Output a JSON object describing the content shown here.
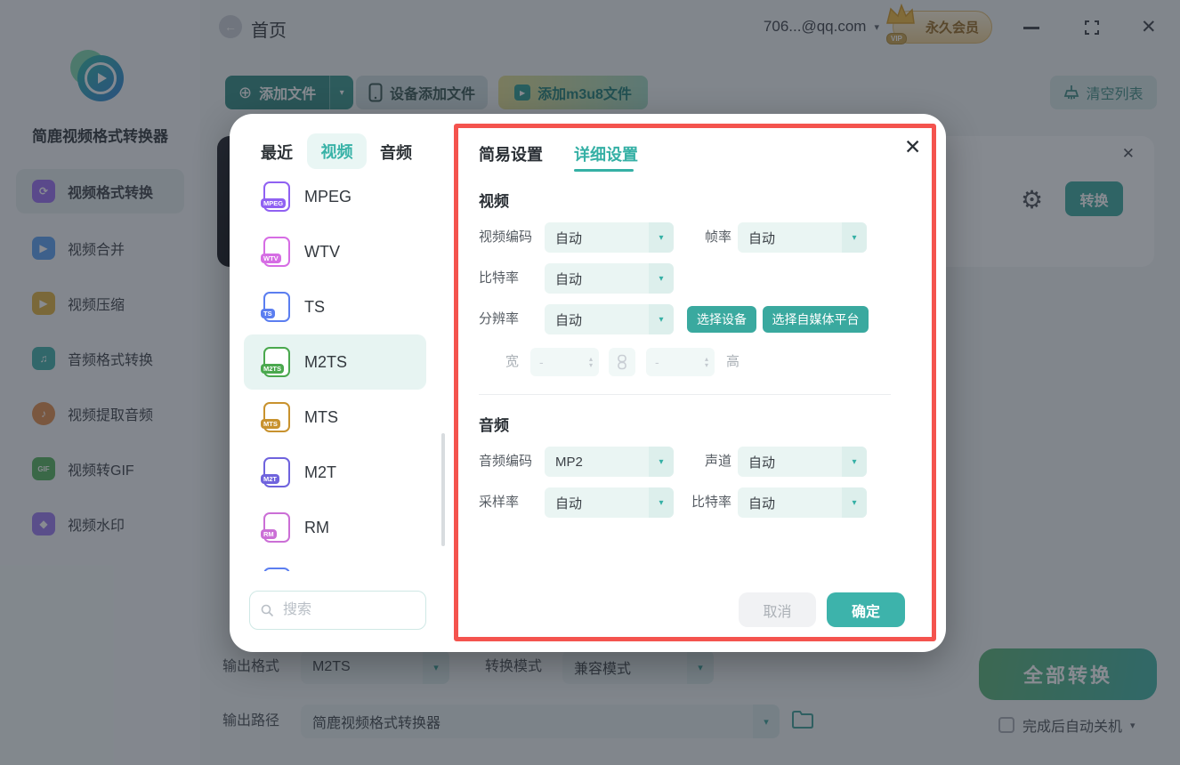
{
  "header": {
    "home": "首页",
    "back_icon": "←",
    "account": "706...@qq.com",
    "vip_badge": "永久会员",
    "vip_tag": "VIP"
  },
  "sidebar": {
    "app_name": "简鹿视频格式转换器",
    "items": [
      {
        "label": "视频格式转换",
        "glyph": "⟳",
        "active": true
      },
      {
        "label": "视频合并",
        "glyph": "▶"
      },
      {
        "label": "视频压缩",
        "glyph": "▶"
      },
      {
        "label": "音频格式转换",
        "glyph": "♫"
      },
      {
        "label": "视频提取音频",
        "glyph": "♪"
      },
      {
        "label": "视频转GIF",
        "glyph": "GIF"
      },
      {
        "label": "视频水印",
        "glyph": "◆"
      }
    ]
  },
  "toolbar": {
    "add_file": "添加文件",
    "add_file_icon": "⊕",
    "device_add_file": "设备添加文件",
    "add_m3u8": "添加m3u8文件",
    "clear_list": "清空列表"
  },
  "file_card": {
    "convert_button": "转换",
    "remove_icon": "✕",
    "gear_icon": "⚙"
  },
  "footer": {
    "output_format_label": "输出格式",
    "output_format_value": "M2TS",
    "convert_mode_label": "转换模式",
    "convert_mode_value": "兼容模式",
    "output_path_label": "输出路径",
    "output_path_value": "简鹿视频格式转换器",
    "convert_all_button": "全部转换",
    "auto_shutdown": "完成后自动关机"
  },
  "modal": {
    "tabs": {
      "recent": "最近",
      "video": "视频",
      "audio": "音频"
    },
    "formats": [
      {
        "name": "MPEG"
      },
      {
        "name": "WTV"
      },
      {
        "name": "TS"
      },
      {
        "name": "M2TS",
        "selected": true
      },
      {
        "name": "MTS"
      },
      {
        "name": "M2T"
      },
      {
        "name": "RM"
      },
      {
        "name": ""
      }
    ],
    "search_placeholder": "搜索",
    "settings": {
      "tab_simple": "简易设置",
      "tab_detailed": "详细设置",
      "close_icon": "✕",
      "video": {
        "title": "视频",
        "video_codec": {
          "label": "视频编码",
          "value": "自动"
        },
        "frame_rate": {
          "label": "帧率",
          "value": "自动"
        },
        "bitrate": {
          "label": "比特率",
          "value": "自动"
        },
        "resolution": {
          "label": "分辨率",
          "value": "自动"
        },
        "select_device": "选择设备",
        "select_media_platform": "选择自媒体平台",
        "width_label": "宽",
        "height_label": "高",
        "dimension_placeholder": "-"
      },
      "audio": {
        "title": "音频",
        "audio_codec": {
          "label": "音频编码",
          "value": "MP2"
        },
        "channels": {
          "label": "声道",
          "value": "自动"
        },
        "sample_rate": {
          "label": "采样率",
          "value": "自动"
        },
        "bitrate": {
          "label": "比特率",
          "value": "自动"
        }
      },
      "cancel": "取消",
      "ok": "确定"
    }
  },
  "colors": {
    "accent_teal": "#3ab3a9",
    "annotation_red": "#f4534e",
    "convert_all_gradient": [
      "#57b273",
      "#3eb2a4"
    ],
    "vip_gold": "#96691f",
    "select_bg": "#eaf5f3",
    "format_icon_colors": {
      "MPEG": "#9061f2",
      "WTV": "#d66de4",
      "TS": "#5b7ef0",
      "M2TS": "#4aa84e",
      "MTS": "#c8922e",
      "M2T": "#6f63dd",
      "RM": "#cb6fd6"
    }
  }
}
